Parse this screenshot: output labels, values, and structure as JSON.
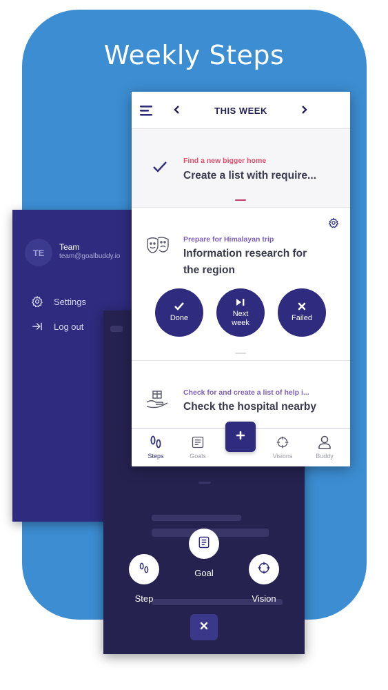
{
  "headline": "Weekly Steps",
  "colors": {
    "brand_blue": "#3c8dd2",
    "primary_purple": "#2f2b7e",
    "dark_overlay": "#252250",
    "pink_accent": "#e0506a",
    "purple_accent": "#7b5fb5"
  },
  "sidebar": {
    "avatar_initials": "TE",
    "user_name": "Team",
    "user_email": "team@goalbuddy.io",
    "items": [
      {
        "label": "Settings",
        "icon": "gear-icon"
      },
      {
        "label": "Log out",
        "icon": "logout-icon"
      }
    ]
  },
  "header": {
    "title": "THIS WEEK",
    "prev_icon": "chevron-left-icon",
    "next_icon": "chevron-right-icon",
    "menu_icon": "menu-icon"
  },
  "goals": [
    {
      "goal": "Find a new bigger home",
      "step": "Create a list with require...",
      "status_icon": "check-icon"
    },
    {
      "goal": "Prepare for Himalayan trip",
      "step_line1": "Information research for",
      "step_line2": "the region",
      "icon": "theater-masks-icon",
      "settings_icon": "gear-icon",
      "actions": [
        {
          "label": "Done",
          "icon": "check-icon"
        },
        {
          "label_line1": "Next",
          "label_line2": "week",
          "icon": "skip-next-icon"
        },
        {
          "label": "Failed",
          "icon": "x-icon"
        }
      ]
    },
    {
      "goal": "Check for and create a list of help i...",
      "step": "Check the hospital nearby",
      "icon": "gift-hand-icon"
    }
  ],
  "tabs": [
    {
      "label": "Steps",
      "icon": "footsteps-icon",
      "active": true
    },
    {
      "label": "Goals",
      "icon": "list-icon",
      "active": false
    },
    {
      "label": "Visions",
      "icon": "crosshair-icon",
      "active": false
    },
    {
      "label": "Buddy",
      "icon": "person-icon",
      "active": false
    }
  ],
  "fab_add_icon": "plus-icon",
  "fab_menu": {
    "step_label": "Step",
    "goal_label": "Goal",
    "vision_label": "Vision",
    "close_icon": "x-icon"
  }
}
